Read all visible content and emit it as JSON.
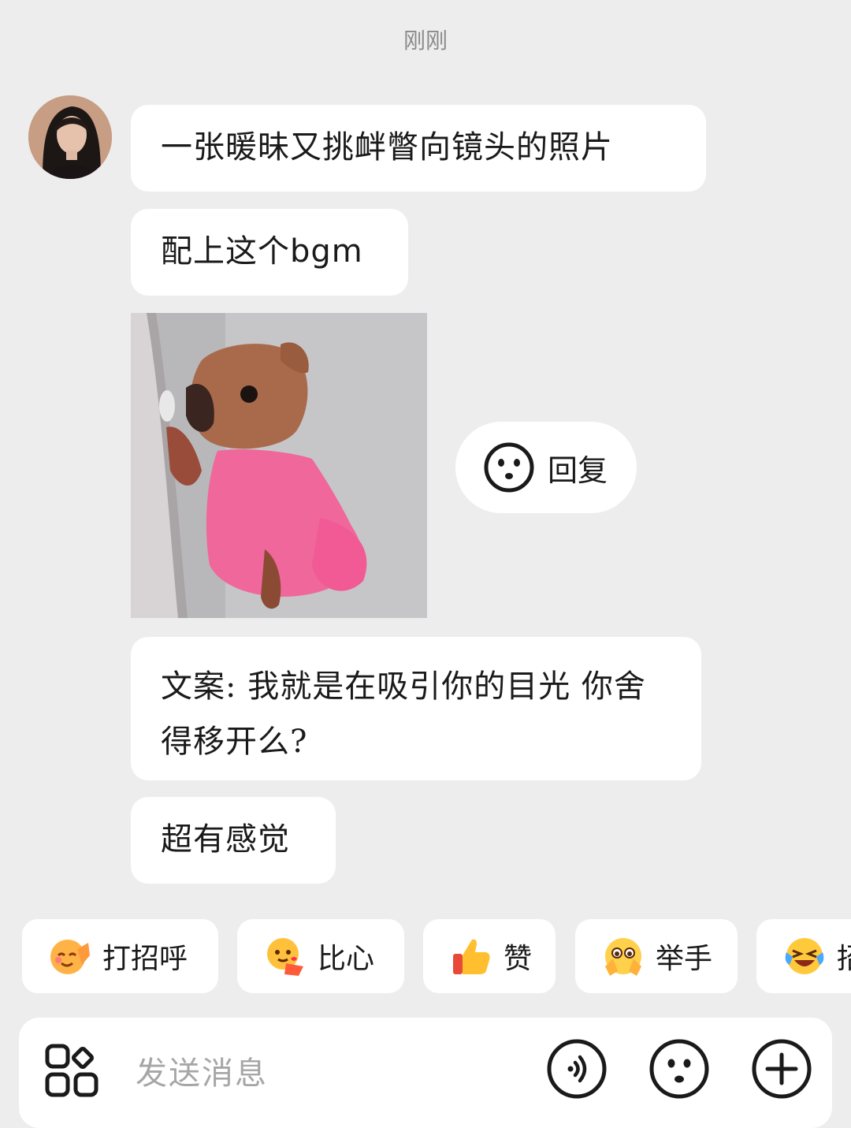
{
  "timestamp": "刚刚",
  "messages": [
    "一张暖昧又挑衅瞥向镜头的照片",
    "配上这个bgm",
    "文案: 我就是在吸引你的目光 你舍得移开么?",
    "超有感觉"
  ],
  "reply_button": {
    "label": "回复",
    "icon": "smiley-face-icon"
  },
  "quick_replies": [
    {
      "label": "打招呼",
      "icon": "wave-emoji-icon"
    },
    {
      "label": "比心",
      "icon": "finger-heart-emoji-icon"
    },
    {
      "label": "赞",
      "icon": "thumbs-up-emoji-icon"
    },
    {
      "label": "举手",
      "icon": "raise-hand-emoji-icon"
    },
    {
      "label": "招",
      "icon": "laughing-emoji-icon"
    }
  ],
  "input": {
    "placeholder": "发送消息",
    "left_icon": "apps-grid-icon",
    "right_icons": [
      "voice-icon",
      "emoji-icon",
      "plus-icon"
    ]
  },
  "colors": {
    "background": "#ededed",
    "bubble": "#ffffff",
    "text": "#1a1a1a",
    "placeholder": "#a6a6a6",
    "dog_shirt": "#f0679b"
  }
}
